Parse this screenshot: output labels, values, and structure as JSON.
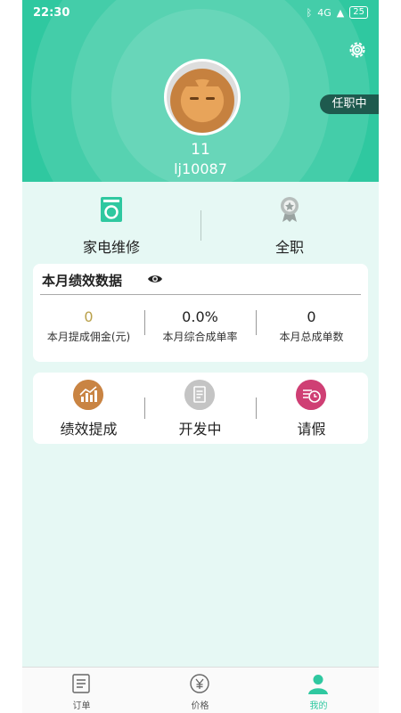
{
  "status_bar": {
    "time": "22:30",
    "battery": "25",
    "signal": "4G"
  },
  "profile": {
    "name": "11",
    "user_id": "lj10087",
    "work_status": "任职中"
  },
  "roles": [
    {
      "label": "家电维修",
      "icon": "repair-device-icon"
    },
    {
      "label": "全职",
      "icon": "fulltime-medal-icon"
    }
  ],
  "performance": {
    "title": "本月绩效数据",
    "stats": [
      {
        "value": "0",
        "label": "本月提成佣金(元)"
      },
      {
        "value": "0.0%",
        "label": "本月综合成单率"
      },
      {
        "value": "0",
        "label": "本月总成单数"
      }
    ]
  },
  "actions": [
    {
      "label": "绩效提成",
      "icon": "performance-chart-icon"
    },
    {
      "label": "开发中",
      "icon": "developing-document-icon"
    },
    {
      "label": "请假",
      "icon": "leave-clock-icon"
    }
  ],
  "nav": [
    {
      "label": "订单",
      "icon": "order-icon"
    },
    {
      "label": "价格",
      "icon": "price-icon"
    },
    {
      "label": "我的",
      "icon": "profile-icon"
    }
  ],
  "colors": {
    "accent": "#2fc8a0",
    "badge": "#1e5a4e",
    "commission": "#b9a04a"
  }
}
